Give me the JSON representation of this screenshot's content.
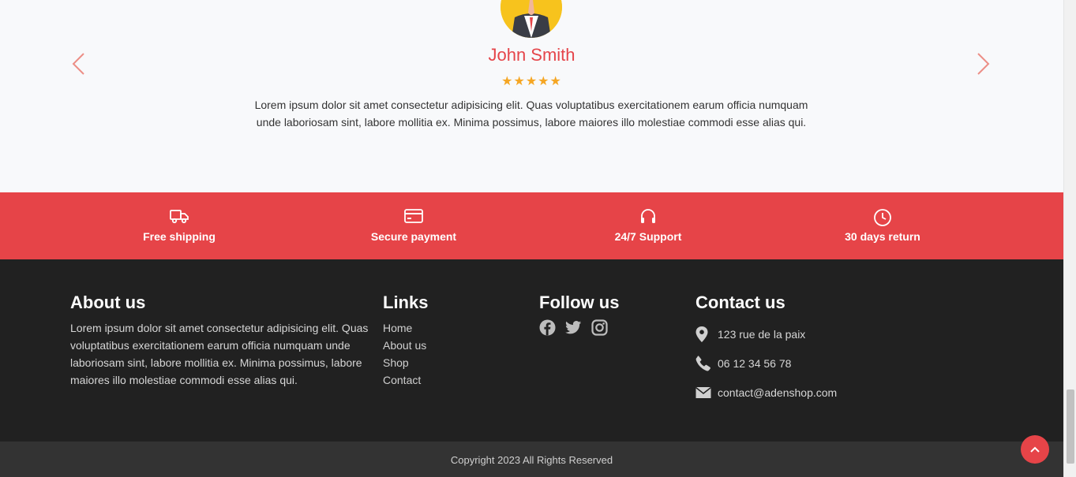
{
  "testimonial": {
    "name": "John Smith",
    "stars": "★★★★★",
    "text": "Lorem ipsum dolor sit amet consectetur adipisicing elit. Quas voluptatibus exercitationem earum officia numquam unde laboriosam sint, labore mollitia ex. Minima possimus, labore maiores illo molestiae commodi esse alias qui.",
    "rating": 5
  },
  "features": [
    {
      "label": "Free shipping",
      "icon": "truck-icon"
    },
    {
      "label": "Secure payment",
      "icon": "credit-card-icon"
    },
    {
      "label": "24/7 Support",
      "icon": "headset-icon"
    },
    {
      "label": "30 days return",
      "icon": "clock-icon"
    }
  ],
  "footer": {
    "about": {
      "title": "About us",
      "text": "Lorem ipsum dolor sit amet consectetur adipisicing elit. Quas voluptatibus exercitationem earum officia numquam unde laboriosam sint, labore mollitia ex. Minima possimus, labore maiores illo molestiae commodi esse alias qui."
    },
    "links": {
      "title": "Links",
      "items": [
        "Home",
        "About us",
        "Shop",
        "Contact"
      ]
    },
    "follow": {
      "title": "Follow us",
      "icons": [
        "facebook-icon",
        "twitter-icon",
        "instagram-icon"
      ]
    },
    "contact": {
      "title": "Contact us",
      "address": "123 rue de la paix",
      "phone": "06 12 34 56 78",
      "email": "contact@adenshop.com"
    },
    "copyright": "Copyright 2023 All Rights Reserved"
  },
  "colors": {
    "accent": "#e64448",
    "footer_bg": "#212121",
    "star": "#f5a623"
  }
}
